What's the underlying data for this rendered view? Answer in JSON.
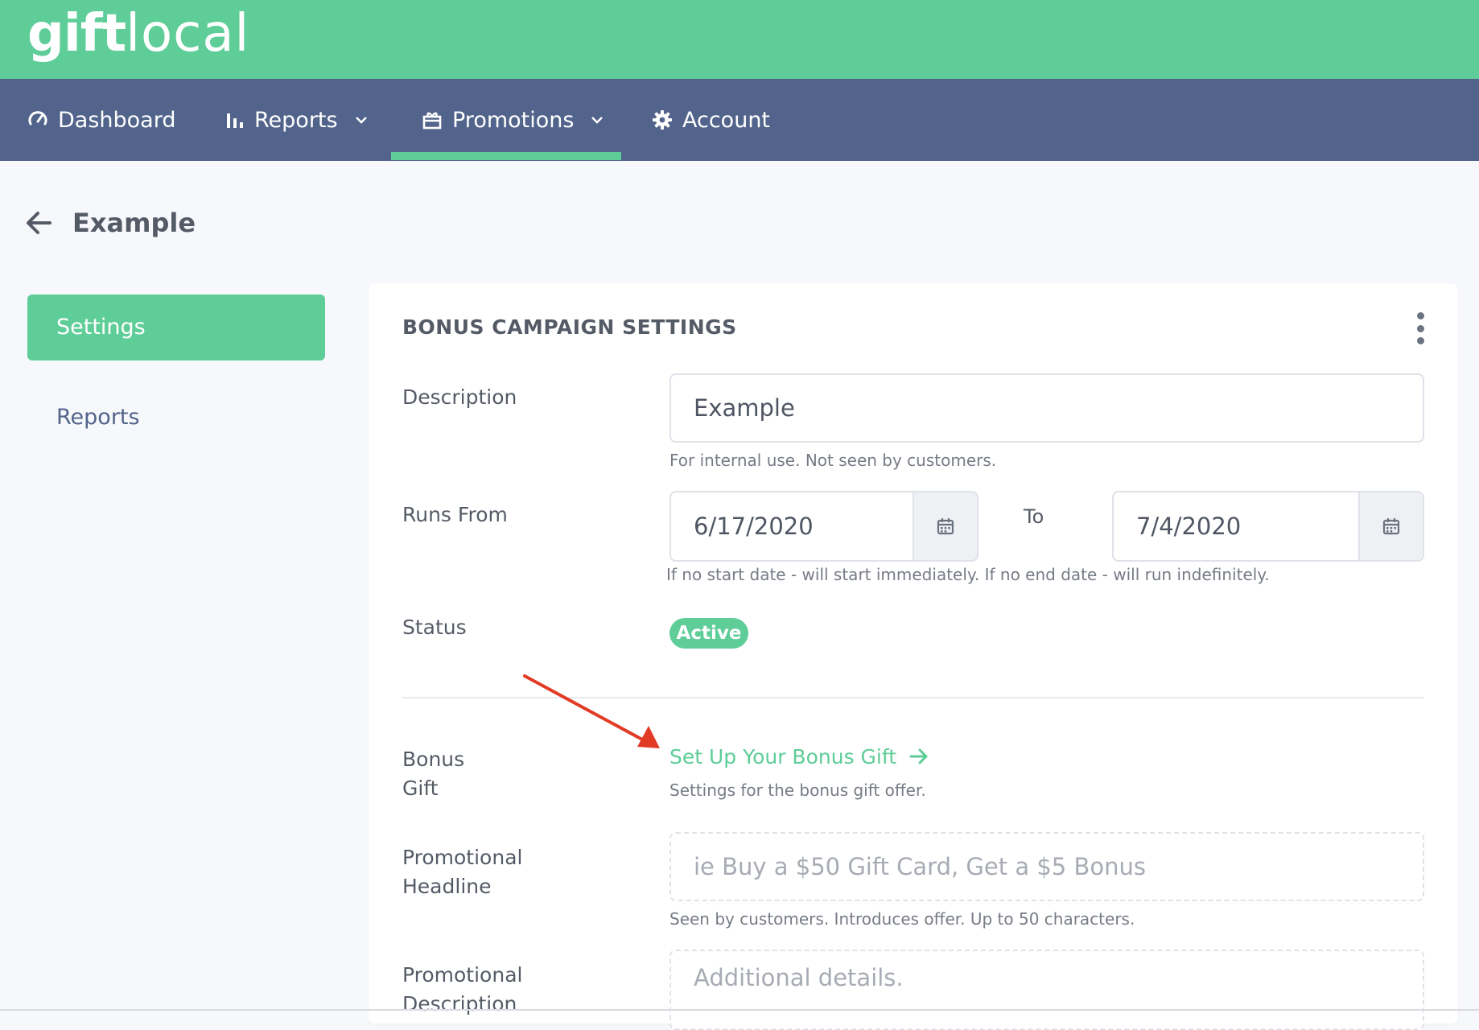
{
  "brand": {
    "logo_bold": "gift",
    "logo_light": "local",
    "color": "#5ecd98"
  },
  "nav": {
    "dashboard": "Dashboard",
    "reports": "Reports",
    "promotions": "Promotions",
    "account": "Account",
    "active_item": "Promotions",
    "bar_color": "#52648b"
  },
  "page": {
    "title": "Example"
  },
  "sidebar": {
    "items": [
      {
        "label": "Settings",
        "active": true
      },
      {
        "label": "Reports",
        "active": false
      }
    ]
  },
  "card": {
    "title": "BONUS CAMPAIGN SETTINGS",
    "description": {
      "label": "Description",
      "value": "Example",
      "help": "For internal use. Not seen by customers."
    },
    "runs": {
      "label": "Runs From",
      "from": "6/17/2020",
      "to_label": "To",
      "to": "7/4/2020",
      "help": "If no start date - will start immediately. If no end date - will run indefinitely."
    },
    "status": {
      "label": "Status",
      "value": "Active"
    },
    "bonus_gift": {
      "label_line1": "Bonus",
      "label_line2": "Gift",
      "link": "Set Up Your Bonus Gift",
      "help": "Settings for the bonus gift offer."
    },
    "promo_headline": {
      "label_line1": "Promotional",
      "label_line2": "Headline",
      "placeholder": "ie Buy a $50 Gift Card, Get a $5 Bonus",
      "help": "Seen by customers. Introduces offer. Up to 50 characters."
    },
    "promo_description": {
      "label_line1": "Promotional",
      "label_line2": "Description",
      "placeholder": "Additional details."
    }
  }
}
